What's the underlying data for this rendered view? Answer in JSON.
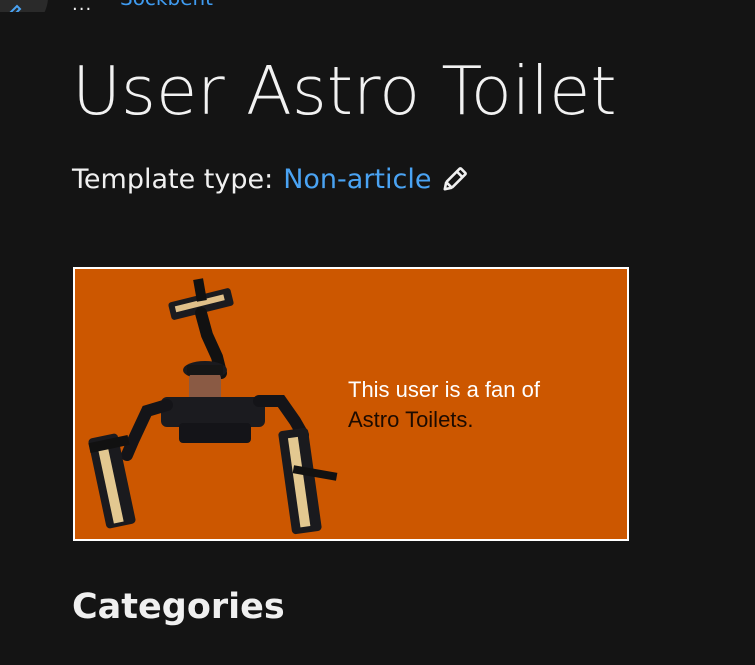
{
  "top_bar": {
    "dots": "...",
    "breadcrumb_link": "Sockbent"
  },
  "page": {
    "title": "User Astro Toilet",
    "template_type_label": "Template type:",
    "template_type_value": "Non-article"
  },
  "userbox": {
    "line1": "This user is a fan of",
    "line2": "Astro Toilets.",
    "background_color": "#cc5700",
    "image": "astro-toilet-robot"
  },
  "sections": {
    "categories_heading": "Categories"
  },
  "colors": {
    "background": "#141414",
    "link": "#4aa3f3",
    "text": "#f0f0f0"
  }
}
